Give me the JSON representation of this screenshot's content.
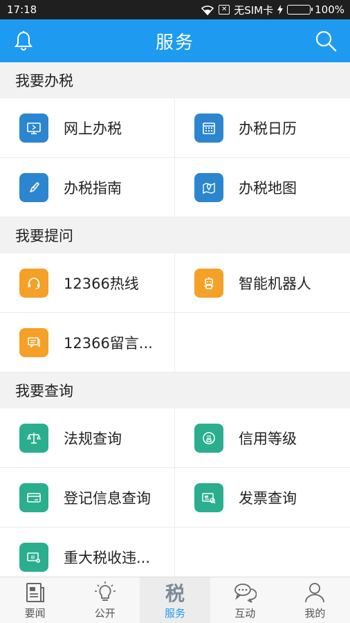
{
  "status": {
    "time": "17:18",
    "carrier": "无SIM卡",
    "battery": "100%"
  },
  "header": {
    "title": "服务"
  },
  "colors": {
    "accent": "#1e9bf0",
    "blue_icon": "#2b86cf",
    "orange_icon": "#f5a026",
    "green_icon": "#2aae8e"
  },
  "sections": [
    {
      "title": "我要办税",
      "items": [
        {
          "label": "网上办税",
          "icon": "monitor-icon"
        },
        {
          "label": "办税日历",
          "icon": "calendar-icon"
        },
        {
          "label": "办税指南",
          "icon": "compass-icon"
        },
        {
          "label": "办税地图",
          "icon": "map-icon"
        }
      ]
    },
    {
      "title": "我要提问",
      "items": [
        {
          "label": "12366热线",
          "icon": "headset-icon"
        },
        {
          "label": "智能机器人",
          "icon": "robot-icon"
        },
        {
          "label": "12366留言...",
          "icon": "message-icon"
        }
      ]
    },
    {
      "title": "我要查询",
      "items": [
        {
          "label": "法规查询",
          "icon": "scale-icon"
        },
        {
          "label": "信用等级",
          "icon": "credit-icon"
        },
        {
          "label": "登记信息查询",
          "icon": "card-icon"
        },
        {
          "label": "发票查询",
          "icon": "invoice-icon"
        },
        {
          "label": "重大税收违...",
          "icon": "tax-icon"
        }
      ]
    }
  ],
  "tabs": [
    {
      "label": "要闻",
      "icon": "news-icon"
    },
    {
      "label": "公开",
      "icon": "bulb-icon"
    },
    {
      "label": "服务",
      "icon": "tax-char-icon"
    },
    {
      "label": "互动",
      "icon": "chat-icon"
    },
    {
      "label": "我的",
      "icon": "person-icon"
    }
  ]
}
